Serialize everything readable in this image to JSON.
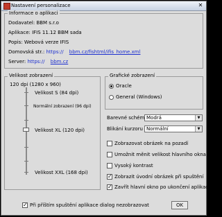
{
  "window": {
    "title": "Nastavení personalizace"
  },
  "info": {
    "legend": "Informace o aplikaci",
    "rows": [
      {
        "label": "Dodavatel:",
        "value": "BBM s.r.o"
      },
      {
        "label": "Aplikace:",
        "value": "IFIS 11.12 BBM sada"
      },
      {
        "label": "Popis:",
        "value": "Webová verze IFIS"
      },
      {
        "label": "Domovská str.:",
        "value": "https://",
        "link": "bbm.cz/fishtml/ifis_home.xml"
      },
      {
        "label": "Server:",
        "value": "https://",
        "link": "bbm.cz"
      }
    ]
  },
  "size": {
    "legend": "Velikost zobrazení",
    "top_label": "120 dpi (1280 x 960)",
    "labels": [
      "Velikost S (84 dpi)",
      "Normální zobrazení (96 dpi)",
      "Velikost XL (120 dpi)",
      "Velikost XXL (168 dpi)"
    ]
  },
  "graphic": {
    "legend": "Grafické zobrazení",
    "options": [
      {
        "label": "Oracle",
        "selected": true
      },
      {
        "label": "General (Windows)",
        "selected": false
      }
    ]
  },
  "scheme": {
    "label": "Barevné schéma",
    "value": "Modrá"
  },
  "cursor": {
    "label": "Blikání kurzoru",
    "value": "Normální"
  },
  "checks": [
    {
      "label": "Zobrazovat obrázek na pozadí",
      "checked": false
    },
    {
      "label": "Umožnit měnit velikost hlavního okna",
      "checked": false
    },
    {
      "label": "Vysoký kontrast",
      "checked": false
    },
    {
      "label": "Zobrazit úvodní obrázek při spuštění",
      "checked": true
    },
    {
      "label": "Zavřít hlavní okno po ukončení aplikace",
      "checked": true
    }
  ],
  "bottom": {
    "startup_check_label": "Při příštím spuštění aplikace dialog nezobrazovat",
    "startup_checked": true,
    "ok_label": "OK"
  },
  "colors": {
    "link": "#1c2fd0",
    "background": "#dcdcdc"
  }
}
